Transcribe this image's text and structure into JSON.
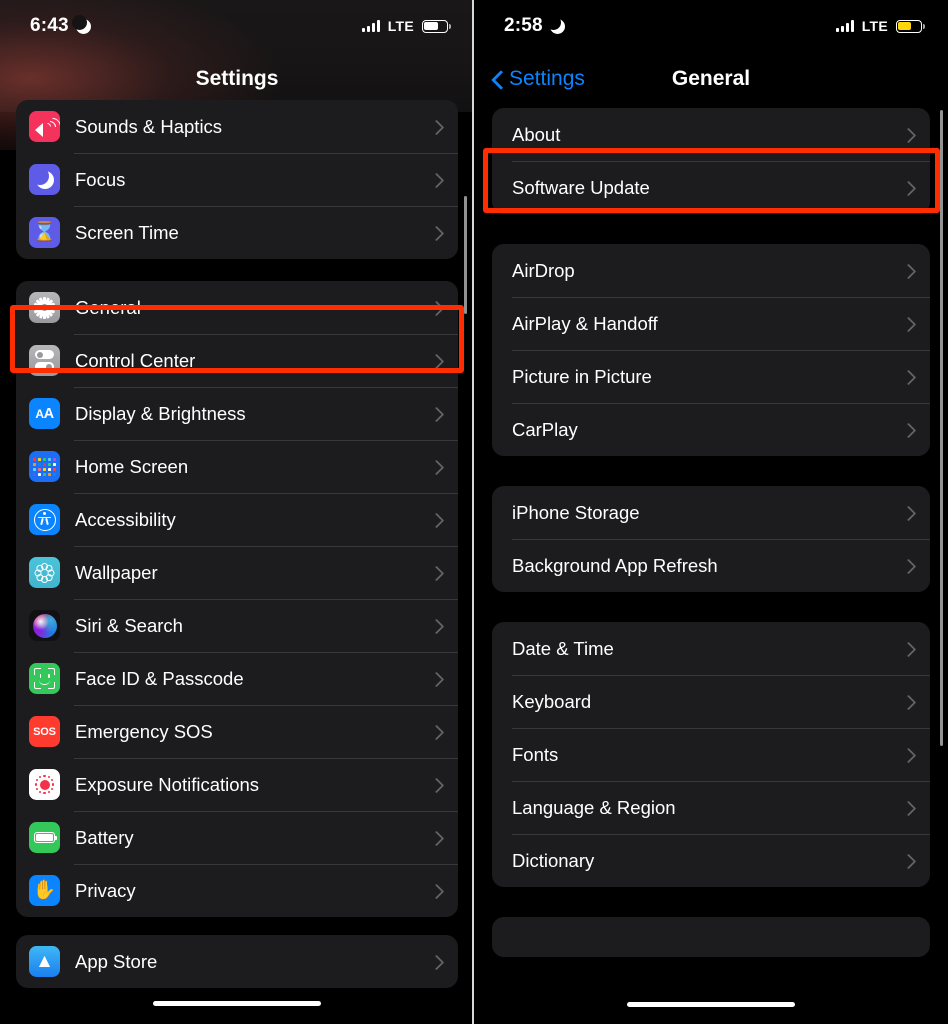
{
  "left": {
    "status": {
      "time": "6:43",
      "moon_icon": "moon-icon",
      "carrier": "LTE",
      "battery_color": "#ffffff",
      "battery_level": 62
    },
    "nav": {
      "title": "Settings"
    },
    "groups": [
      {
        "rows": [
          {
            "label": "Sounds & Haptics",
            "icon": "sound-icon"
          },
          {
            "label": "Focus",
            "icon": "moon-icon"
          },
          {
            "label": "Screen Time",
            "icon": "hourglass-icon"
          }
        ]
      },
      {
        "rows": [
          {
            "label": "General",
            "icon": "gear-icon"
          },
          {
            "label": "Control Center",
            "icon": "control-center-icon"
          },
          {
            "label": "Display & Brightness",
            "icon": "display-brightness-icon"
          },
          {
            "label": "Home Screen",
            "icon": "home-screen-icon"
          },
          {
            "label": "Accessibility",
            "icon": "accessibility-icon"
          },
          {
            "label": "Wallpaper",
            "icon": "wallpaper-icon"
          },
          {
            "label": "Siri & Search",
            "icon": "siri-icon"
          },
          {
            "label": "Face ID & Passcode",
            "icon": "face-id-icon"
          },
          {
            "label": "Emergency SOS",
            "icon": "sos-icon"
          },
          {
            "label": "Exposure Notifications",
            "icon": "exposure-notifications-icon"
          },
          {
            "label": "Battery",
            "icon": "battery-icon"
          },
          {
            "label": "Privacy",
            "icon": "privacy-hand-icon"
          }
        ]
      },
      {
        "rows": [
          {
            "label": "App Store",
            "icon": "app-store-icon"
          }
        ]
      }
    ],
    "highlight": {
      "target": "General",
      "color": "#ff2d00"
    }
  },
  "right": {
    "status": {
      "time": "2:58",
      "moon_icon": "moon-icon",
      "carrier": "LTE",
      "battery_color": "#ffd60a",
      "battery_level": 58
    },
    "nav": {
      "back_label": "Settings",
      "title": "General"
    },
    "groups": [
      {
        "rows": [
          {
            "label": "About"
          },
          {
            "label": "Software Update"
          }
        ]
      },
      {
        "rows": [
          {
            "label": "AirDrop"
          },
          {
            "label": "AirPlay & Handoff"
          },
          {
            "label": "Picture in Picture"
          },
          {
            "label": "CarPlay"
          }
        ]
      },
      {
        "rows": [
          {
            "label": "iPhone Storage"
          },
          {
            "label": "Background App Refresh"
          }
        ]
      },
      {
        "rows": [
          {
            "label": "Date & Time"
          },
          {
            "label": "Keyboard"
          },
          {
            "label": "Fonts"
          },
          {
            "label": "Language & Region"
          },
          {
            "label": "Dictionary"
          }
        ]
      }
    ],
    "highlight": {
      "target": "About",
      "color": "#ff2d00"
    }
  }
}
